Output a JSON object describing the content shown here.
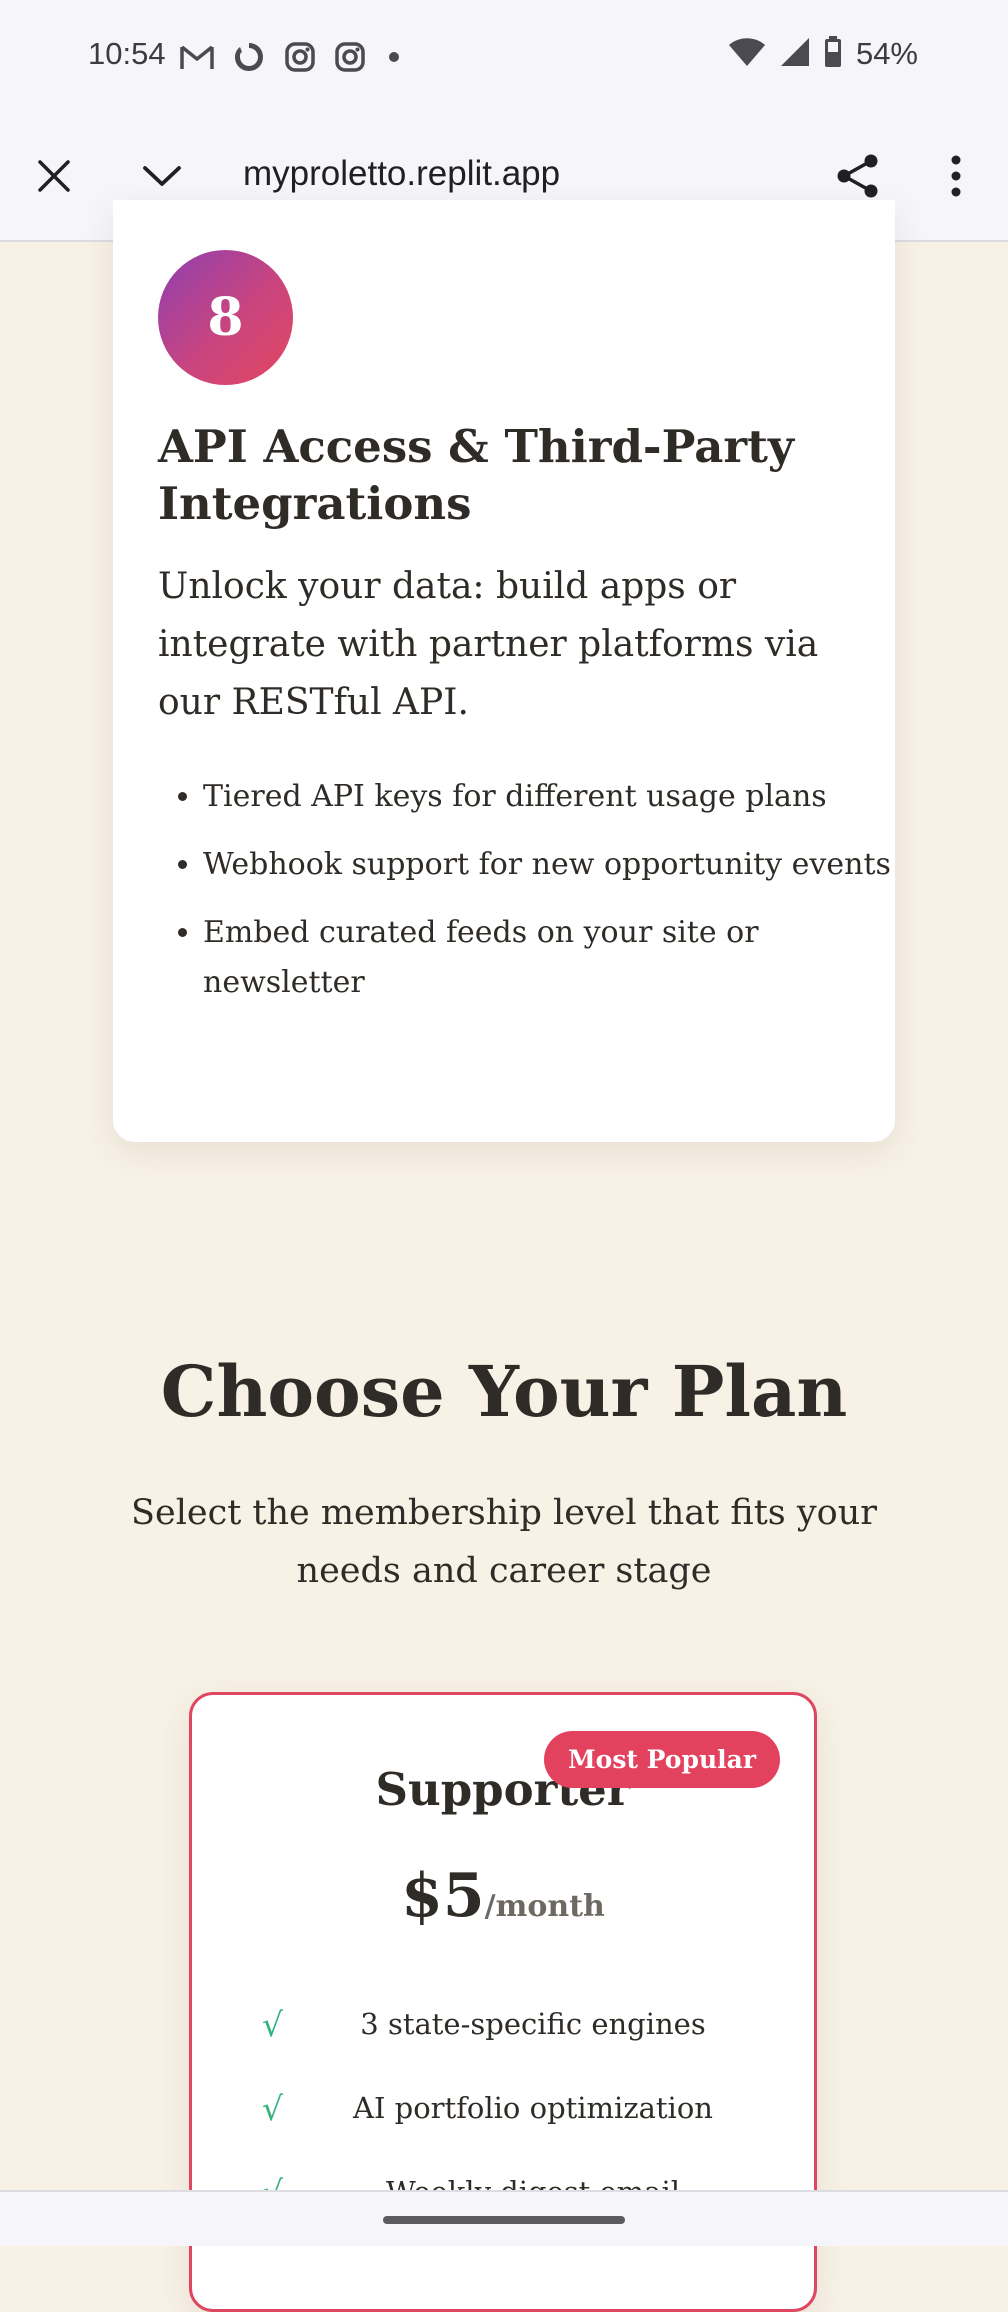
{
  "status_bar": {
    "time": "10:54",
    "left_icons": [
      "gmail-icon",
      "claude-icon",
      "instagram-icon",
      "instagram-icon",
      "dot-icon"
    ],
    "right_icons": [
      "wifi-icon",
      "signal-icon",
      "battery-icon"
    ],
    "battery": "54%"
  },
  "toolbar": {
    "close_icon": "close-icon",
    "collapse_icon": "chevron-down-icon",
    "url": "myproletto.replit.app",
    "share_icon": "share-icon",
    "menu_icon": "more-vert-icon"
  },
  "feature_card": {
    "number": "8",
    "title": "API Access & Third-Party Integrations",
    "description": "Unlock your data: build apps or integrate with partner platforms via our RESTful API.",
    "items": [
      "Tiered API keys for different usage plans",
      "Webhook support for new opportunity events",
      "Embed curated feeds on your site or newsletter"
    ]
  },
  "plans": {
    "title": "Choose Your Plan",
    "subtitle": "Select the membership level that fits your needs and career stage",
    "card": {
      "badge": "Most Popular",
      "name": "Supporter",
      "price": "$5",
      "period": "/month",
      "features": [
        "3 state-specific engines",
        "AI portfolio optimization",
        "Weekly digest email"
      ]
    }
  },
  "colors": {
    "page_background": "#f7f1e6",
    "accent": "#e3425f",
    "check": "#35b37e",
    "badge_gradient_start": "#8e3fb0",
    "badge_gradient_end": "#e3465e"
  }
}
